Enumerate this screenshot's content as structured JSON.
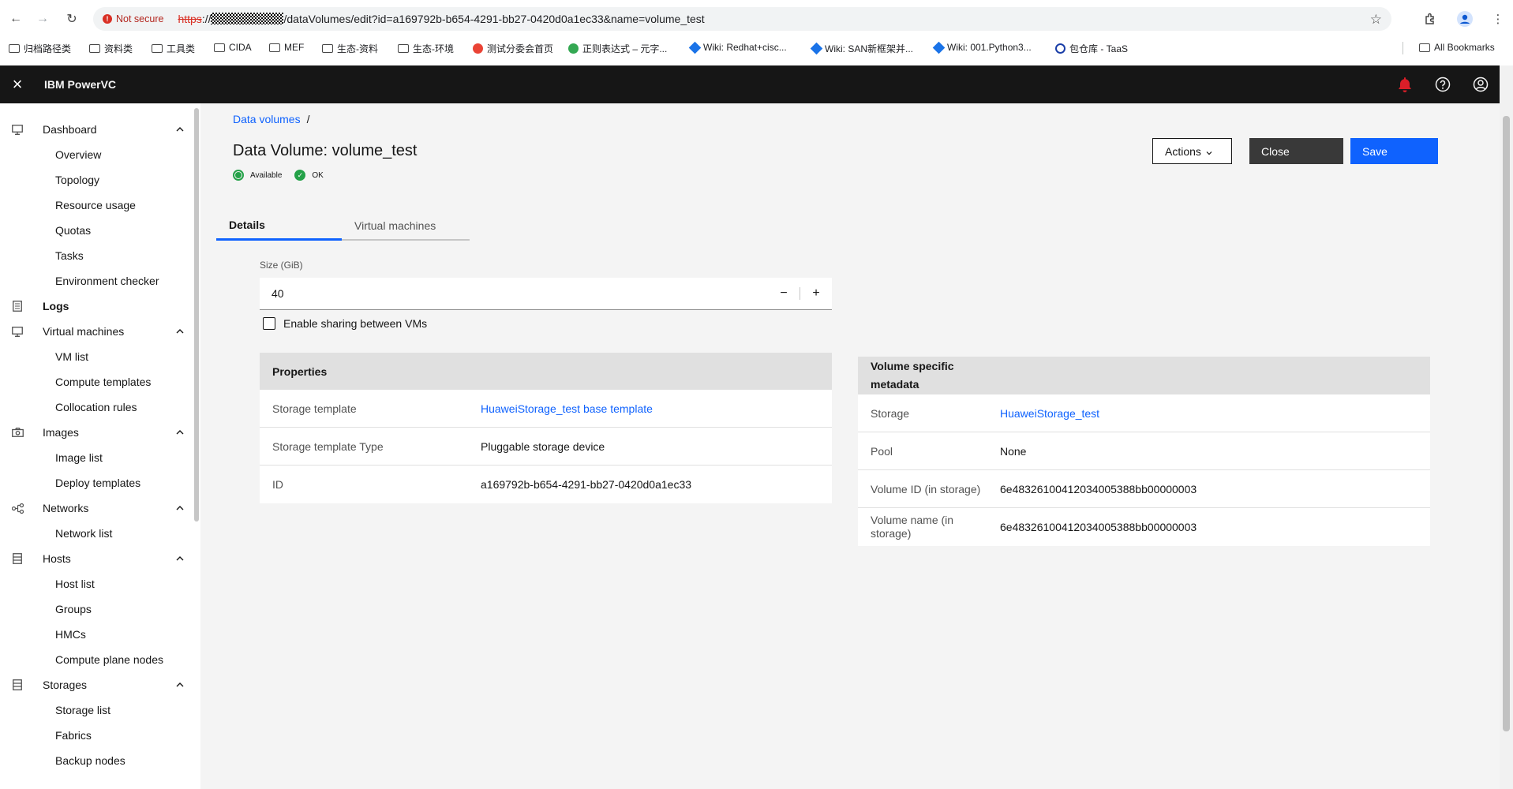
{
  "browser": {
    "not_secure": "Not secure",
    "url_scheme": "https",
    "url_sep": "://",
    "url_path": "/dataVolumes/edit?id=a169792b-b654-4291-bb27-0420d0a1ec33&name=volume_test",
    "bookmarks": [
      "归档路径类",
      "资料类",
      "工具类",
      "CIDA",
      "MEF",
      "生态-资料",
      "生态-环境",
      "测试分委会首页",
      "正则表达式 – 元字...",
      "Wiki: Redhat+cisc...",
      "Wiki: SAN新框架并...",
      "Wiki: 001.Python3...",
      "包仓库 - TaaS"
    ],
    "all_bookmarks": "All Bookmarks"
  },
  "app": {
    "title": "IBM PowerVC"
  },
  "sidebar": {
    "groups": [
      {
        "label": "Dashboard",
        "items": [
          "Overview",
          "Topology",
          "Resource usage",
          "Quotas",
          "Tasks",
          "Environment checker"
        ]
      },
      {
        "label": "Logs",
        "items": []
      },
      {
        "label": "Virtual machines",
        "items": [
          "VM list",
          "Compute templates",
          "Collocation rules"
        ]
      },
      {
        "label": "Images",
        "items": [
          "Image list",
          "Deploy templates"
        ]
      },
      {
        "label": "Networks",
        "items": [
          "Network list"
        ]
      },
      {
        "label": "Hosts",
        "items": [
          "Host list",
          "Groups",
          "HMCs",
          "Compute plane nodes"
        ]
      },
      {
        "label": "Storages",
        "items": [
          "Storage list",
          "Fabrics",
          "Backup nodes"
        ]
      }
    ]
  },
  "main": {
    "breadcrumb": "Data volumes",
    "breadcrumb_sep": "/",
    "title": "Data Volume: volume_test",
    "status_available": "Available",
    "status_ok": "OK",
    "actions_label": "Actions",
    "close_label": "Close",
    "save_label": "Save",
    "tabs": [
      "Details",
      "Virtual machines"
    ],
    "size_label": "Size (GiB)",
    "size_value": "40",
    "decrement": "−",
    "increment": "+",
    "sharing_label": "Enable sharing between VMs",
    "properties": {
      "title": "Properties",
      "rows": [
        {
          "k": "Storage template",
          "v": "HuaweiStorage_test base template"
        },
        {
          "k": "Storage template Type",
          "v": "Pluggable storage device"
        },
        {
          "k": "ID",
          "v": "a169792b-b654-4291-bb27-0420d0a1ec33"
        }
      ]
    },
    "metadata": {
      "title_line1": "Volume specific",
      "title_line2": "metadata",
      "rows": [
        {
          "k": "Storage",
          "v": "HuaweiStorage_test"
        },
        {
          "k": "Pool",
          "v": "None"
        },
        {
          "k": "Volume ID (in storage)",
          "v": "6e48326100412034005388bb00000003"
        },
        {
          "k": "Volume name (in storage)",
          "v": "6e48326100412034005388bb00000003"
        }
      ]
    }
  },
  "colors": {
    "accent": "#0f62fe",
    "header": "#161616",
    "success": "#24a148",
    "alert": "#da1e28"
  }
}
